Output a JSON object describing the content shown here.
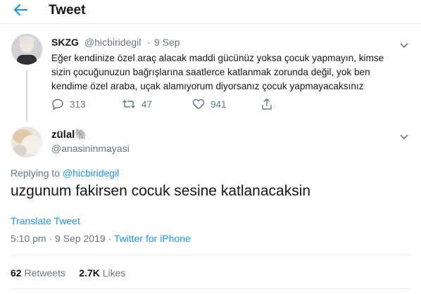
{
  "header": {
    "title": "Tweet"
  },
  "quoted_tweet": {
    "display_name": "SKZG",
    "handle": "@hicbiridegil",
    "separator": "·",
    "time": "9 Sep",
    "text": "Eğer kendinize özel araç alacak maddi gücünüz yoksa çocuk yapmayın, kimse sizin çocuğunuzun bağrışlarına saatlerce katlanmak zorunda değil, yok ben kendime özel araba, uçak alamıyorum diyorsanız çocuk yapmayacaksınız",
    "actions": {
      "replies": "313",
      "retweets": "47",
      "likes": "941"
    }
  },
  "main_tweet": {
    "display_name": "zülal🐘",
    "handle": "@anasininmayasi",
    "replying_label": "Replying to",
    "replying_handle": "@hicbiridegil",
    "text": "uzgunum fakirsen cocuk sesine katlanacaksin",
    "translate": "Translate Tweet",
    "timestamp": "5:10 pm · 9 Sep 2019",
    "meta_separator": "·",
    "source": "Twitter for iPhone",
    "retweets_count": "62",
    "retweets_label": "Retweets",
    "likes_count": "2.7K",
    "likes_label": "Likes"
  },
  "colors": {
    "accent": "#1b95e0",
    "muted": "#657786",
    "text": "#14171a",
    "divider": "#e6ecf0"
  },
  "icons": [
    "back-arrow-icon",
    "chevron-down-icon",
    "reply-icon",
    "retweet-icon",
    "like-icon",
    "share-icon"
  ]
}
